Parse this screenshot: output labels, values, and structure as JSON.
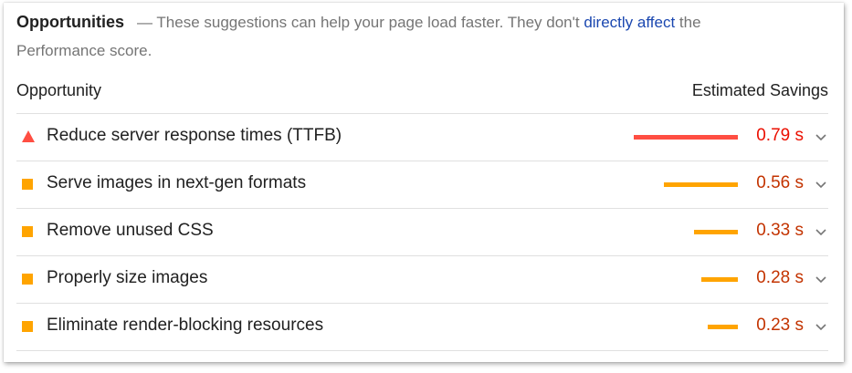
{
  "header": {
    "title": "Opportunities",
    "description_before": "— These suggestions can help your page load faster. They don't ",
    "link_text": "directly affect",
    "description_after": " the Performance score."
  },
  "columns": {
    "left": "Opportunity",
    "right": "Estimated Savings"
  },
  "colors": {
    "fail": "#ff4e42",
    "average": "#ffa400",
    "fail_text": "#eb0f00",
    "average_text": "#c33300"
  },
  "audits": [
    {
      "label": "Reduce server response times (TTFB)",
      "savings": "0.79 s",
      "savings_seconds": 0.79,
      "rating": "fail",
      "icon": "warning-triangle-icon"
    },
    {
      "label": "Serve images in next-gen formats",
      "savings": "0.56 s",
      "savings_seconds": 0.56,
      "rating": "average",
      "icon": "average-square-icon"
    },
    {
      "label": "Remove unused CSS",
      "savings": "0.33 s",
      "savings_seconds": 0.33,
      "rating": "average",
      "icon": "average-square-icon"
    },
    {
      "label": "Properly size images",
      "savings": "0.28 s",
      "savings_seconds": 0.28,
      "rating": "average",
      "icon": "average-square-icon"
    },
    {
      "label": "Eliminate render-blocking resources",
      "savings": "0.23 s",
      "savings_seconds": 0.23,
      "rating": "average",
      "icon": "average-square-icon"
    }
  ]
}
